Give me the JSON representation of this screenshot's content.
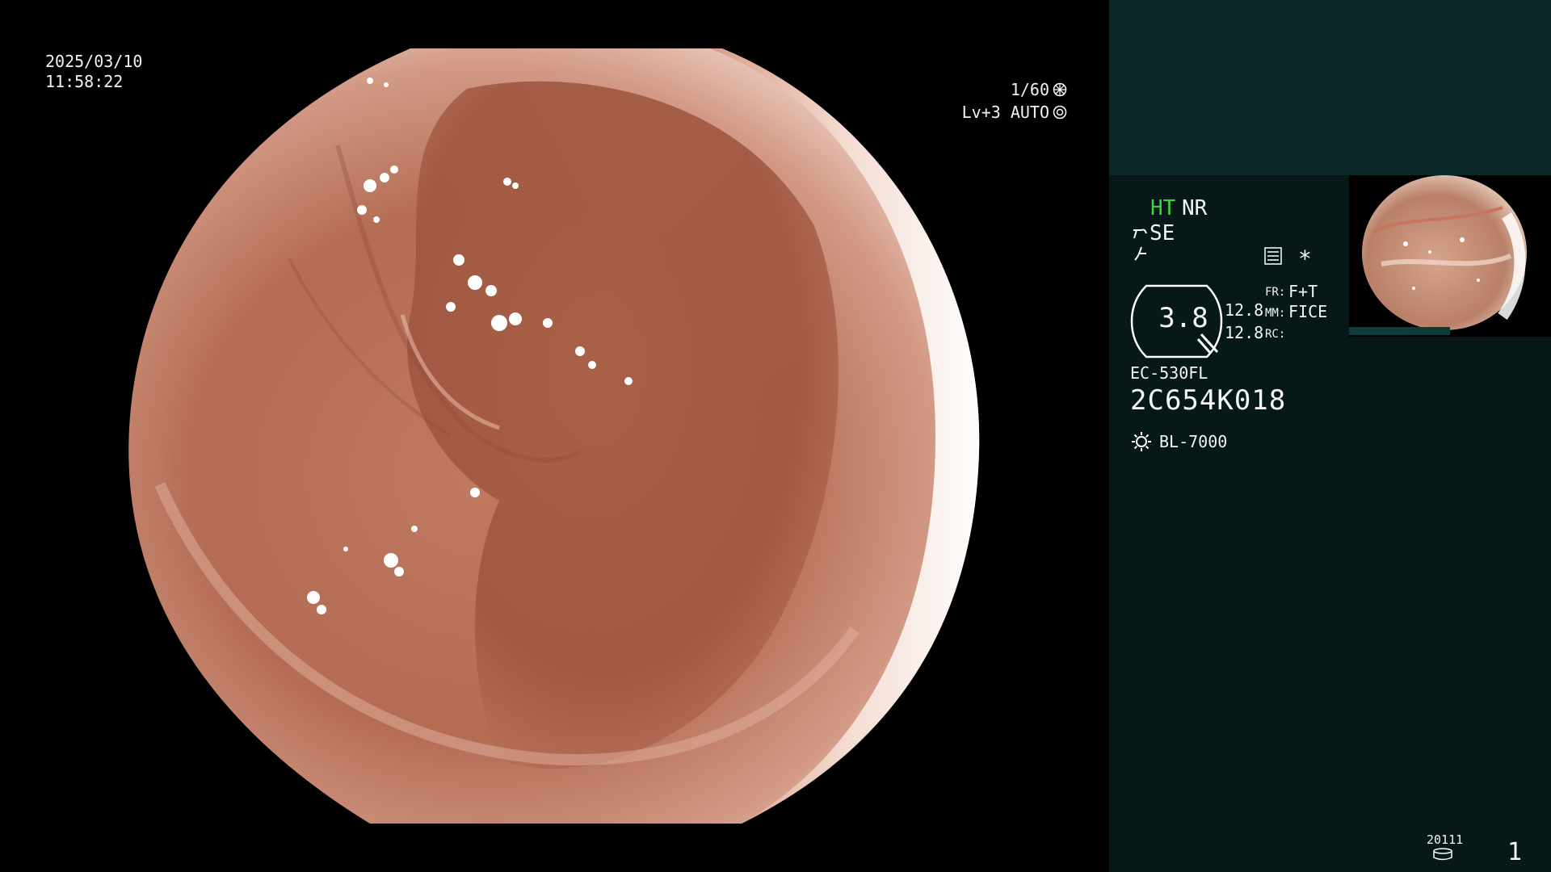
{
  "osd": {
    "date": "2025/03/10",
    "time": "11:58:22",
    "shutter": "1/60",
    "level": "Lv+3 AUTO"
  },
  "panel": {
    "ht": "HT",
    "nr": "NR",
    "se": "SE",
    "zoom": "3.8",
    "val_a": "12.8",
    "val_b": "12.8",
    "fr_key": "FR:",
    "fr_value": "F+T",
    "mm_key": "MM:",
    "mm_value": "FICE",
    "rc_key": "RC:",
    "asterisk": "*",
    "scope_model": "EC-530FL",
    "scope_serial": "2C654K018",
    "light_source": "BL-7000",
    "code": "20111",
    "page": "1"
  },
  "colors": {
    "panel_bg": "#061818",
    "panel_top_band": "#0d2828",
    "ht_green": "#3fd43f",
    "tissue": "#b86e56"
  },
  "icons": [
    "shutter-icon",
    "auto-iris-icon",
    "scissors-icon",
    "sharpness-icon",
    "statistics-icon",
    "zoom-badge-icon",
    "light-icon",
    "storage-icon"
  ]
}
